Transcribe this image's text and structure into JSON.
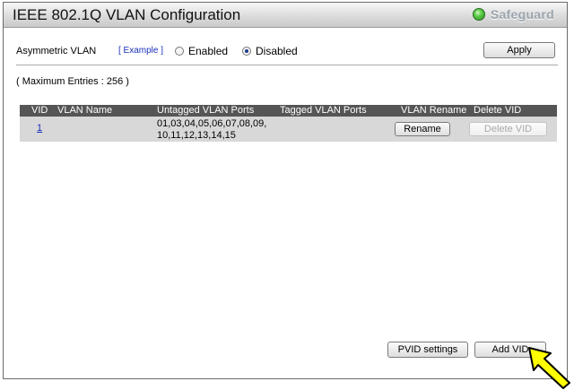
{
  "window": {
    "title": "IEEE 802.1Q VLAN Configuration",
    "brand": "Safeguard",
    "brand_led_color": "#4cc43a"
  },
  "asymmetric": {
    "label": "Asymmetric VLAN",
    "example_link": "[ Example ]",
    "option_enabled": "Enabled",
    "option_disabled": "Disabled",
    "selected": "Disabled",
    "apply_label": "Apply"
  },
  "max_entries": "( Maximum Entries : 256 )",
  "table": {
    "headers": {
      "vid": "VID",
      "vlan_name": "VLAN Name",
      "untagged": "Untagged VLAN Ports",
      "tagged": "Tagged VLAN Ports",
      "rename": "VLAN Rename",
      "delete": "Delete VID"
    },
    "rows": [
      {
        "vid": "1",
        "vlan_name": "",
        "untagged_line1": "01,03,04,05,06,07,08,09,",
        "untagged_line2": "10,11,12,13,14,15",
        "tagged": "",
        "rename_label": "Rename",
        "delete_label": "Delete VID"
      }
    ]
  },
  "footer": {
    "pvid_label": "PVID settings",
    "add_vid_label": "Add VID"
  },
  "colors": {
    "header_bg": "#555555",
    "row_bg": "#d8d8d8",
    "link": "#1a2fb8",
    "pointer_arrow": "#ffff00"
  },
  "icons": {
    "brand": "status-led-icon",
    "pointer": "pointer-arrow-icon"
  }
}
